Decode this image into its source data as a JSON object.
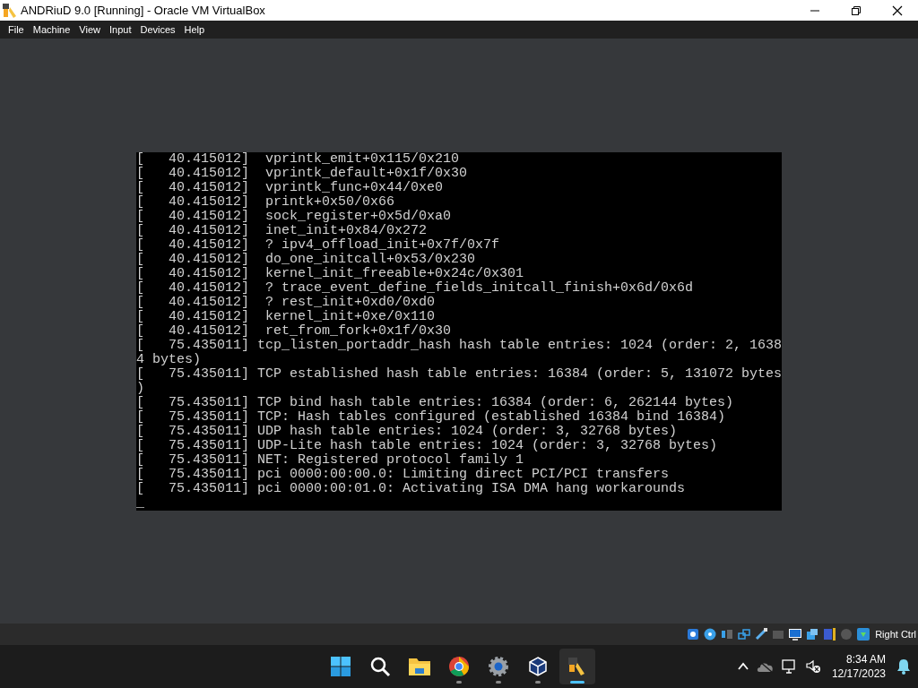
{
  "window": {
    "title": "ANDRiuD 9.0 [Running] - Oracle VM VirtualBox"
  },
  "menu": [
    "File",
    "Machine",
    "View",
    "Input",
    "Devices",
    "Help"
  ],
  "console": {
    "lines": [
      "[   40.415012]  vprintk_emit+0x115/0x210",
      "[   40.415012]  vprintk_default+0x1f/0x30",
      "[   40.415012]  vprintk_func+0x44/0xe0",
      "[   40.415012]  printk+0x50/0x66",
      "[   40.415012]  sock_register+0x5d/0xa0",
      "[   40.415012]  inet_init+0x84/0x272",
      "[   40.415012]  ? ipv4_offload_init+0x7f/0x7f",
      "[   40.415012]  do_one_initcall+0x53/0x230",
      "[   40.415012]  kernel_init_freeable+0x24c/0x301",
      "[   40.415012]  ? trace_event_define_fields_initcall_finish+0x6d/0x6d",
      "[   40.415012]  ? rest_init+0xd0/0xd0",
      "[   40.415012]  kernel_init+0xe/0x110",
      "[   40.415012]  ret_from_fork+0x1f/0x30",
      "[   75.435011] tcp_listen_portaddr_hash hash table entries: 1024 (order: 2, 1638",
      "4 bytes)",
      "[   75.435011] TCP established hash table entries: 16384 (order: 5, 131072 bytes",
      ")",
      "[   75.435011] TCP bind hash table entries: 16384 (order: 6, 262144 bytes)",
      "[   75.435011] TCP: Hash tables configured (established 16384 bind 16384)",
      "[   75.435011] UDP hash table entries: 1024 (order: 3, 32768 bytes)",
      "[   75.435011] UDP-Lite hash table entries: 1024 (order: 3, 32768 bytes)",
      "[   75.435011] NET: Registered protocol family 1",
      "[   75.435011] pci 0000:00:00.0: Limiting direct PCI/PCI transfers",
      "[   75.435011] pci 0000:00:01.0: Activating ISA DMA hang workarounds"
    ],
    "cursor": "_"
  },
  "status_bar": {
    "host_key": "Right Ctrl"
  },
  "taskbar": {
    "apps": [
      {
        "kind": "start",
        "running": false,
        "active": false
      },
      {
        "kind": "search",
        "running": false,
        "active": false
      },
      {
        "kind": "folder",
        "running": false,
        "active": false
      },
      {
        "kind": "browser",
        "running": true,
        "active": false
      },
      {
        "kind": "gear",
        "running": true,
        "active": false
      },
      {
        "kind": "cube",
        "running": true,
        "active": false
      },
      {
        "kind": "vm",
        "running": true,
        "active": true
      }
    ],
    "time": "8:34 AM",
    "date": "12/17/2023"
  }
}
